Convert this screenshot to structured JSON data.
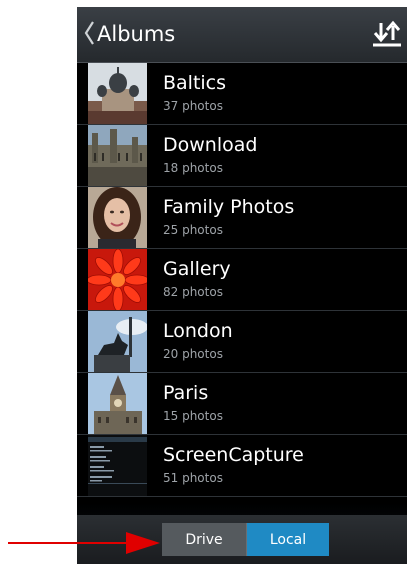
{
  "header": {
    "title": "Albums",
    "back_icon": "chevron-left-icon",
    "sort_icon": "sort-up-down-icon"
  },
  "albums": [
    {
      "name": "Baltics",
      "count": "37 photos",
      "thumb_icon": "domed-building-photo"
    },
    {
      "name": "Download",
      "count": "18 photos",
      "thumb_icon": "parliament-building-photo"
    },
    {
      "name": "Family Photos",
      "count": "25 photos",
      "thumb_icon": "portrait-photo"
    },
    {
      "name": "Gallery",
      "count": "82 photos",
      "thumb_icon": "red-flower-photo"
    },
    {
      "name": "London",
      "count": "20 photos",
      "thumb_icon": "statue-photo"
    },
    {
      "name": "Paris",
      "count": "15 photos",
      "thumb_icon": "clock-tower-photo"
    },
    {
      "name": "ScreenCapture",
      "count": "51 photos",
      "thumb_icon": "settings-screenshot-photo"
    }
  ],
  "bottom": {
    "drive_label": "Drive",
    "local_label": "Local",
    "selected": "Local"
  },
  "colors": {
    "accent": "#1f8ac4",
    "annotation": "#e00000"
  }
}
